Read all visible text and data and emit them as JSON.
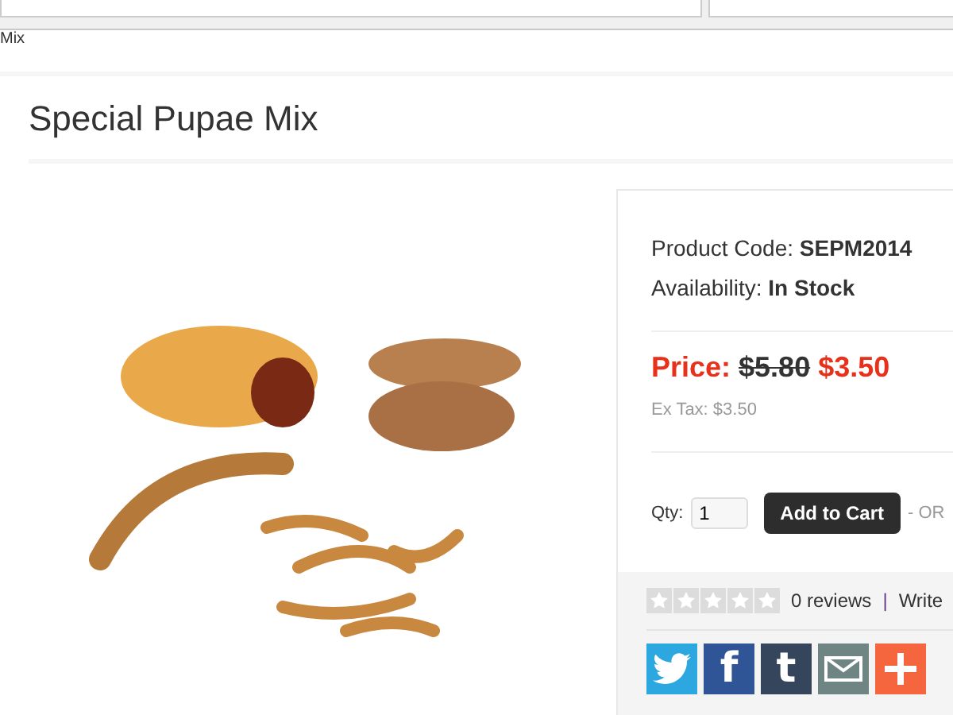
{
  "breadcrumb": "Mix",
  "product": {
    "title": "Special Pupae Mix",
    "code_label": "Product Code:",
    "code": "SEPM2014",
    "availability_label": "Availability:",
    "availability": "In Stock"
  },
  "price": {
    "label": "Price:",
    "old": "$5.80",
    "new": "$3.50",
    "ex_tax": "Ex Tax: $3.50"
  },
  "cart": {
    "qty_label": "Qty:",
    "qty": "1",
    "button": "Add to Cart",
    "or": "- OR"
  },
  "reviews": {
    "stars": 0,
    "count": "0 reviews",
    "separator": "|",
    "write": "Write"
  },
  "share": [
    {
      "kind": "twitter",
      "color": "#2ca7e0"
    },
    {
      "kind": "facebook",
      "color": "#2f5597",
      "glyph": "f"
    },
    {
      "kind": "tumblr",
      "color": "#35465c",
      "glyph": "t"
    },
    {
      "kind": "email",
      "color": "#6e8584"
    },
    {
      "kind": "plus",
      "color": "#f5653e"
    }
  ]
}
